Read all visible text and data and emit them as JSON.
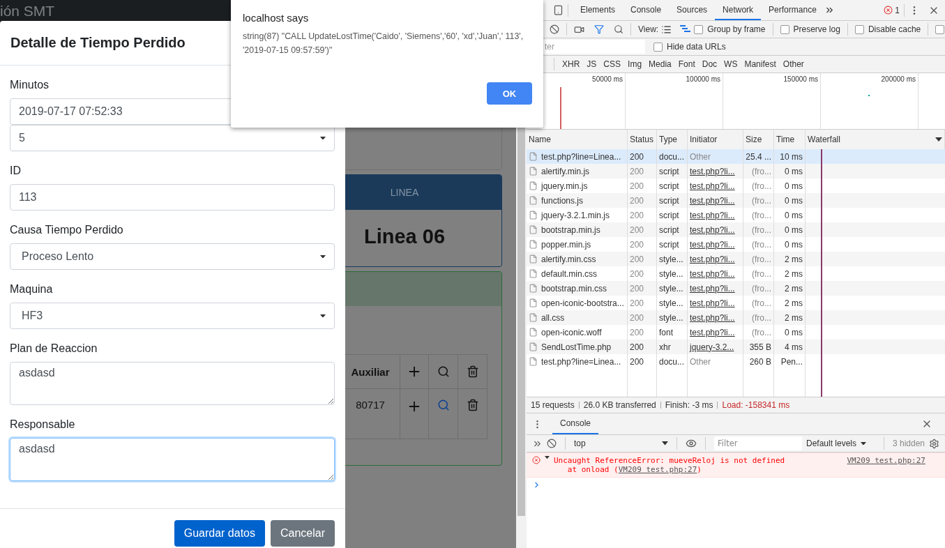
{
  "page": {
    "navbar_title": "ión SMT",
    "line_card": {
      "header": "LINEA",
      "value": "Linea 06"
    },
    "table": {
      "header": "Auxiliar",
      "cell": "80717"
    }
  },
  "modal": {
    "title": "Detalle de Tiempo Perdido",
    "fields": [
      {
        "kind": "input",
        "label": "Minutos",
        "value": "2019-07-17 07:52:33",
        "focused": false
      },
      {
        "kind": "select",
        "value": "5",
        "focused": false
      },
      {
        "kind": "input",
        "label": "ID",
        "value": "113",
        "focused": false
      },
      {
        "kind": "select",
        "label": "Causa Tiempo Perdido",
        "value": "Proceso Lento",
        "focused": false
      },
      {
        "kind": "select",
        "label": "Maquina",
        "value": "HF3",
        "focused": false
      },
      {
        "kind": "textarea",
        "label": "Plan de Reaccion",
        "value": "asdasd",
        "focused": false
      },
      {
        "kind": "textarea",
        "label": "Responsable",
        "value": "asdasd",
        "focused": true
      }
    ],
    "buttons": [
      {
        "label": "Guardar datos",
        "kind": "primary"
      },
      {
        "label": "Cancelar",
        "kind": "secondary"
      }
    ]
  },
  "alert": {
    "title": "localhost says",
    "message": "string(87) \"CALL UpdateLostTime('Caido', 'Siemens','60', 'xd','Juan',' 113', '2019-07-15 09:57:59')\"",
    "button": "OK"
  },
  "devtools": {
    "tabs": [
      {
        "label": "Elements",
        "selected": false
      },
      {
        "label": "Console",
        "selected": false
      },
      {
        "label": "Sources",
        "selected": false
      },
      {
        "label": "Network",
        "selected": true
      },
      {
        "label": "Performance",
        "selected": false
      }
    ],
    "error_count": "1",
    "view_label": "View:",
    "options": [
      {
        "label": "Group by frame",
        "checked": false
      },
      {
        "label": "Preserve log",
        "checked": false
      },
      {
        "label": "Disable cache",
        "checked": false
      },
      {
        "checked": false
      }
    ],
    "filter": {
      "placeholder": "ter"
    },
    "hide_data_urls": {
      "label": "Hide data URLs",
      "checked": false
    },
    "types": [
      "XHR",
      "JS",
      "CSS",
      "Img",
      "Media",
      "Font",
      "Doc",
      "WS",
      "Manifest",
      "Other"
    ],
    "overview_ticks": [
      "50000 ms",
      "100000 ms",
      "150000 ms",
      "200000 ms"
    ],
    "columns": [
      "Name",
      "Status",
      "Type",
      "Initiator",
      "Size",
      "Time",
      "Waterfall"
    ],
    "rows": [
      {
        "name": "test.php?line=Linea...",
        "status": "200",
        "type": "docu...",
        "initiator": "Other",
        "initiator_link": false,
        "size": "25.4 ...",
        "time": "10 ms",
        "cached": false,
        "selected": true
      },
      {
        "name": "alertify.min.js",
        "status": "200",
        "type": "script",
        "initiator": "test.php?li...",
        "initiator_link": true,
        "size": "(fro...",
        "time": "0 ms",
        "cached": true,
        "selected": false
      },
      {
        "name": "jquery.min.js",
        "status": "200",
        "type": "script",
        "initiator": "test.php?li...",
        "initiator_link": true,
        "size": "(fro...",
        "time": "0 ms",
        "cached": true,
        "selected": false
      },
      {
        "name": "functions.js",
        "status": "200",
        "type": "script",
        "initiator": "test.php?li...",
        "initiator_link": true,
        "size": "(fro...",
        "time": "0 ms",
        "cached": true,
        "selected": false
      },
      {
        "name": "jquery-3.2.1.min.js",
        "status": "200",
        "type": "script",
        "initiator": "test.php?li...",
        "initiator_link": true,
        "size": "(fro...",
        "time": "0 ms",
        "cached": true,
        "selected": false
      },
      {
        "name": "bootstrap.min.js",
        "status": "200",
        "type": "script",
        "initiator": "test.php?li...",
        "initiator_link": true,
        "size": "(fro...",
        "time": "0 ms",
        "cached": true,
        "selected": false
      },
      {
        "name": "popper.min.js",
        "status": "200",
        "type": "script",
        "initiator": "test.php?li...",
        "initiator_link": true,
        "size": "(fro...",
        "time": "0 ms",
        "cached": true,
        "selected": false
      },
      {
        "name": "alertify.min.css",
        "status": "200",
        "type": "style...",
        "initiator": "test.php?li...",
        "initiator_link": true,
        "size": "(fro...",
        "time": "2 ms",
        "cached": true,
        "selected": false
      },
      {
        "name": "default.min.css",
        "status": "200",
        "type": "style...",
        "initiator": "test.php?li...",
        "initiator_link": true,
        "size": "(fro...",
        "time": "2 ms",
        "cached": true,
        "selected": false
      },
      {
        "name": "bootstrap.min.css",
        "status": "200",
        "type": "style...",
        "initiator": "test.php?li...",
        "initiator_link": true,
        "size": "(fro...",
        "time": "2 ms",
        "cached": true,
        "selected": false
      },
      {
        "name": "open-iconic-bootstra...",
        "status": "200",
        "type": "style...",
        "initiator": "test.php?li...",
        "initiator_link": true,
        "size": "(fro...",
        "time": "2 ms",
        "cached": true,
        "selected": false
      },
      {
        "name": "all.css",
        "status": "200",
        "type": "style...",
        "initiator": "test.php?li...",
        "initiator_link": true,
        "size": "(fro...",
        "time": "2 ms",
        "cached": true,
        "selected": false
      },
      {
        "name": "open-iconic.woff",
        "status": "200",
        "type": "font",
        "initiator": "test.php?li...",
        "initiator_link": true,
        "size": "(fro...",
        "time": "0 ms",
        "cached": true,
        "selected": false
      },
      {
        "name": "SendLostTime.php",
        "status": "200",
        "type": "xhr",
        "initiator": "jquery-3.2...",
        "initiator_link": true,
        "size": "355 B",
        "time": "4 ms",
        "cached": false,
        "selected": false
      },
      {
        "name": "test.php?line=Linea...",
        "status": "200",
        "type": "docu...",
        "initiator": "Other",
        "initiator_link": false,
        "size": "260 B",
        "time": "Pen...",
        "cached": false,
        "selected": false
      }
    ],
    "summary": [
      {
        "text": "15 requests",
        "kind": "normal"
      },
      {
        "text": "26.0 KB transferred",
        "kind": "normal"
      },
      {
        "text": "Finish: -3 ms",
        "kind": "normal"
      },
      {
        "text": "Load: -158341 ms",
        "kind": "load"
      }
    ],
    "console": {
      "tab": "Console",
      "context": "top",
      "filter_placeholder": "Filter",
      "levels": "Default levels",
      "hidden": "3 hidden",
      "error": {
        "message": "Uncaught ReferenceError: mueveReloj is not defined",
        "stack_prefix": "at onload (",
        "stack_link": "VM209 test.php:27",
        "stack_suffix": ")",
        "source": "VM209 test.php:27"
      }
    }
  }
}
